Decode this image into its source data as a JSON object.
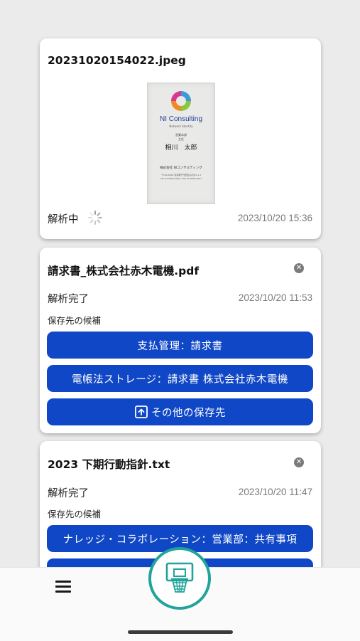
{
  "cards": [
    {
      "filename": "20231020154022.jpeg",
      "status": "解析中",
      "date": "2023/10/20 15:36",
      "business_card": {
        "company": "NI Consulting",
        "tagline": "Network Identity",
        "title1": "営業本部",
        "title2": "主任",
        "name": "相川　太郎",
        "org": "株式会社 NIコンサルティング",
        "address1": "〒100-0000 東京都千代田区丸の内1-1-1",
        "address2": "TEL 03-0000-0000 / FAX 03-0000-0001"
      }
    },
    {
      "filename": "請求書_株式会社赤木電機.pdf",
      "status": "解析完了",
      "date": "2023/10/20 11:53",
      "candidates_label": "保存先の候補",
      "destinations": [
        "支払管理：請求書",
        "電帳法ストレージ：請求書 株式会社赤木電機"
      ],
      "other_label": "その他の保存先"
    },
    {
      "filename": "2023 下期行動指針.txt",
      "status": "解析完了",
      "date": "2023/10/20 11:47",
      "candidates_label": "保存先の候補",
      "destinations": [
        "ナレッジ・コラボレーション：営業部：共有事項"
      ]
    }
  ],
  "colors": {
    "button": "#1047c6",
    "fab_ring": "#21a49a",
    "background": "#ebebeb"
  },
  "icons": [
    "close-icon",
    "spinner-icon",
    "upload-box-icon",
    "menu-icon",
    "basketball-hoop-icon"
  ]
}
